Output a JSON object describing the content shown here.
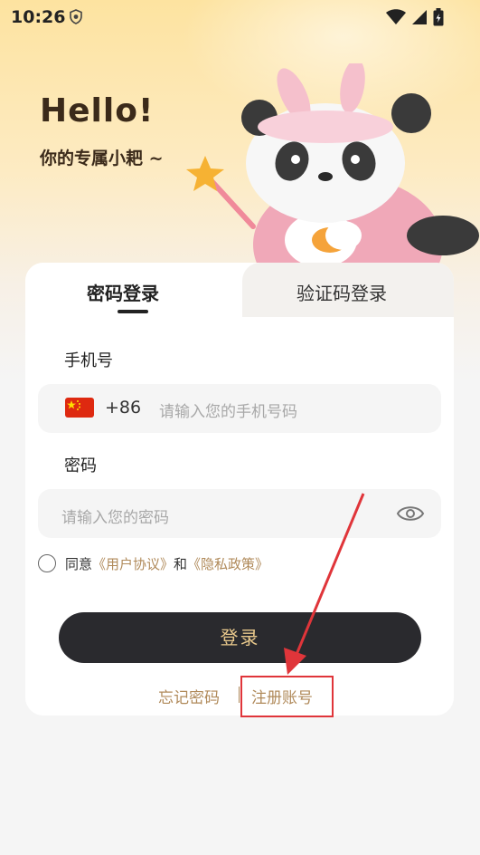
{
  "status_bar": {
    "time": "10:26"
  },
  "header": {
    "greeting": "Hello!",
    "subtitle": "你的专属小耙 ~"
  },
  "tabs": {
    "password_login": "密码登录",
    "code_login": "验证码登录"
  },
  "form": {
    "phone_label": "手机号",
    "country_code": "+86",
    "phone_placeholder": "请输入您的手机号码",
    "password_label": "密码",
    "password_placeholder": "请输入您的密码"
  },
  "agreement": {
    "prefix": "同意",
    "user_agreement": "《用户协议》",
    "and": "和",
    "privacy_policy": "《隐私政策》"
  },
  "login_button": "登录",
  "links": {
    "forgot_password": "忘记密码",
    "register": "注册账号",
    "separator": "|"
  },
  "colors": {
    "accent": "#b08a5a",
    "button_bg": "#2a2a2e",
    "button_text": "#e9c98c",
    "annotation_red": "#e0353a"
  }
}
